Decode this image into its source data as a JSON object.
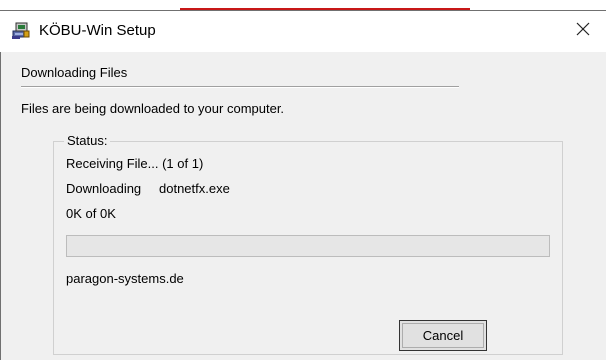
{
  "window": {
    "title": "KÖBU-Win Setup",
    "icon": "setup-computer-icon",
    "close_icon": "close-icon"
  },
  "header": {
    "title": "Downloading Files"
  },
  "info": {
    "text": "Files are being downloaded to your computer."
  },
  "status": {
    "legend": "Status:",
    "receiving": "Receiving File... (1 of 1)",
    "downloading_label": "Downloading",
    "filename": "dotnetfx.exe",
    "size": "0K of 0K",
    "progress_fraction": 0,
    "site": "paragon-systems.de"
  },
  "buttons": {
    "cancel_label": "Cancel"
  },
  "colors": {
    "window_bg": "#f0f0f0",
    "titlebar_bg": "#ffffff",
    "progress_fill": "#06b025"
  }
}
